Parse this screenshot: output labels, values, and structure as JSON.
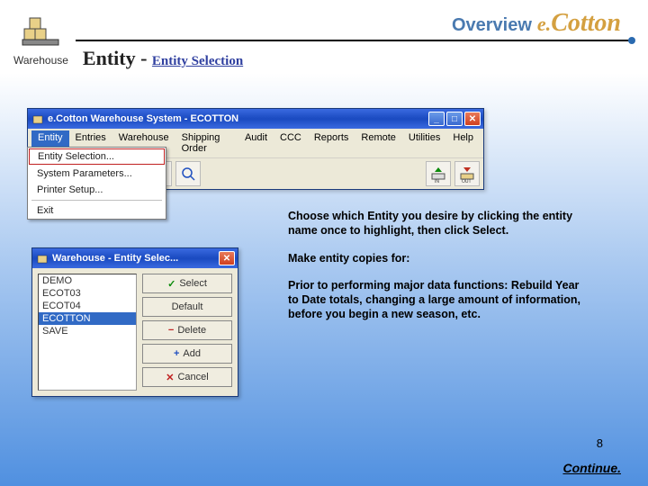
{
  "header": {
    "warehouse_label": "Warehouse",
    "overview": "Overview",
    "brand_e": "e.",
    "brand_cotton": "Cotton",
    "heading_prefix": "Entity - ",
    "heading_sub": "Entity Selection"
  },
  "app": {
    "title": "e.Cotton  Warehouse  System - ECOTTON",
    "menu": [
      "Entity",
      "Entries",
      "Warehouse",
      "Shipping Order",
      "Audit",
      "CCC",
      "Reports",
      "Remote",
      "Utilities",
      "Help"
    ]
  },
  "dropdown": {
    "items": [
      "Entity Selection...",
      "System Parameters...",
      "Printer Setup..."
    ],
    "exit": "Exit"
  },
  "dialog": {
    "title": "Warehouse - Entity Selec...",
    "entities": [
      "DEMO",
      "ECOT03",
      "ECOT04",
      "ECOTTON",
      "SAVE"
    ],
    "selected_index": 3,
    "buttons": {
      "select": "Select",
      "default": "Default",
      "delete": "Delete",
      "add": "Add",
      "cancel": "Cancel"
    }
  },
  "instructions": {
    "p1": "Choose which Entity you desire by clicking the entity name once to highlight, then click Select.",
    "p2": "Make entity copies for:",
    "p3": "Prior to performing major data functions: Rebuild Year to Date totals, changing a large amount of information, before you begin a new season, etc."
  },
  "page_number": "8",
  "continue": "Continue."
}
